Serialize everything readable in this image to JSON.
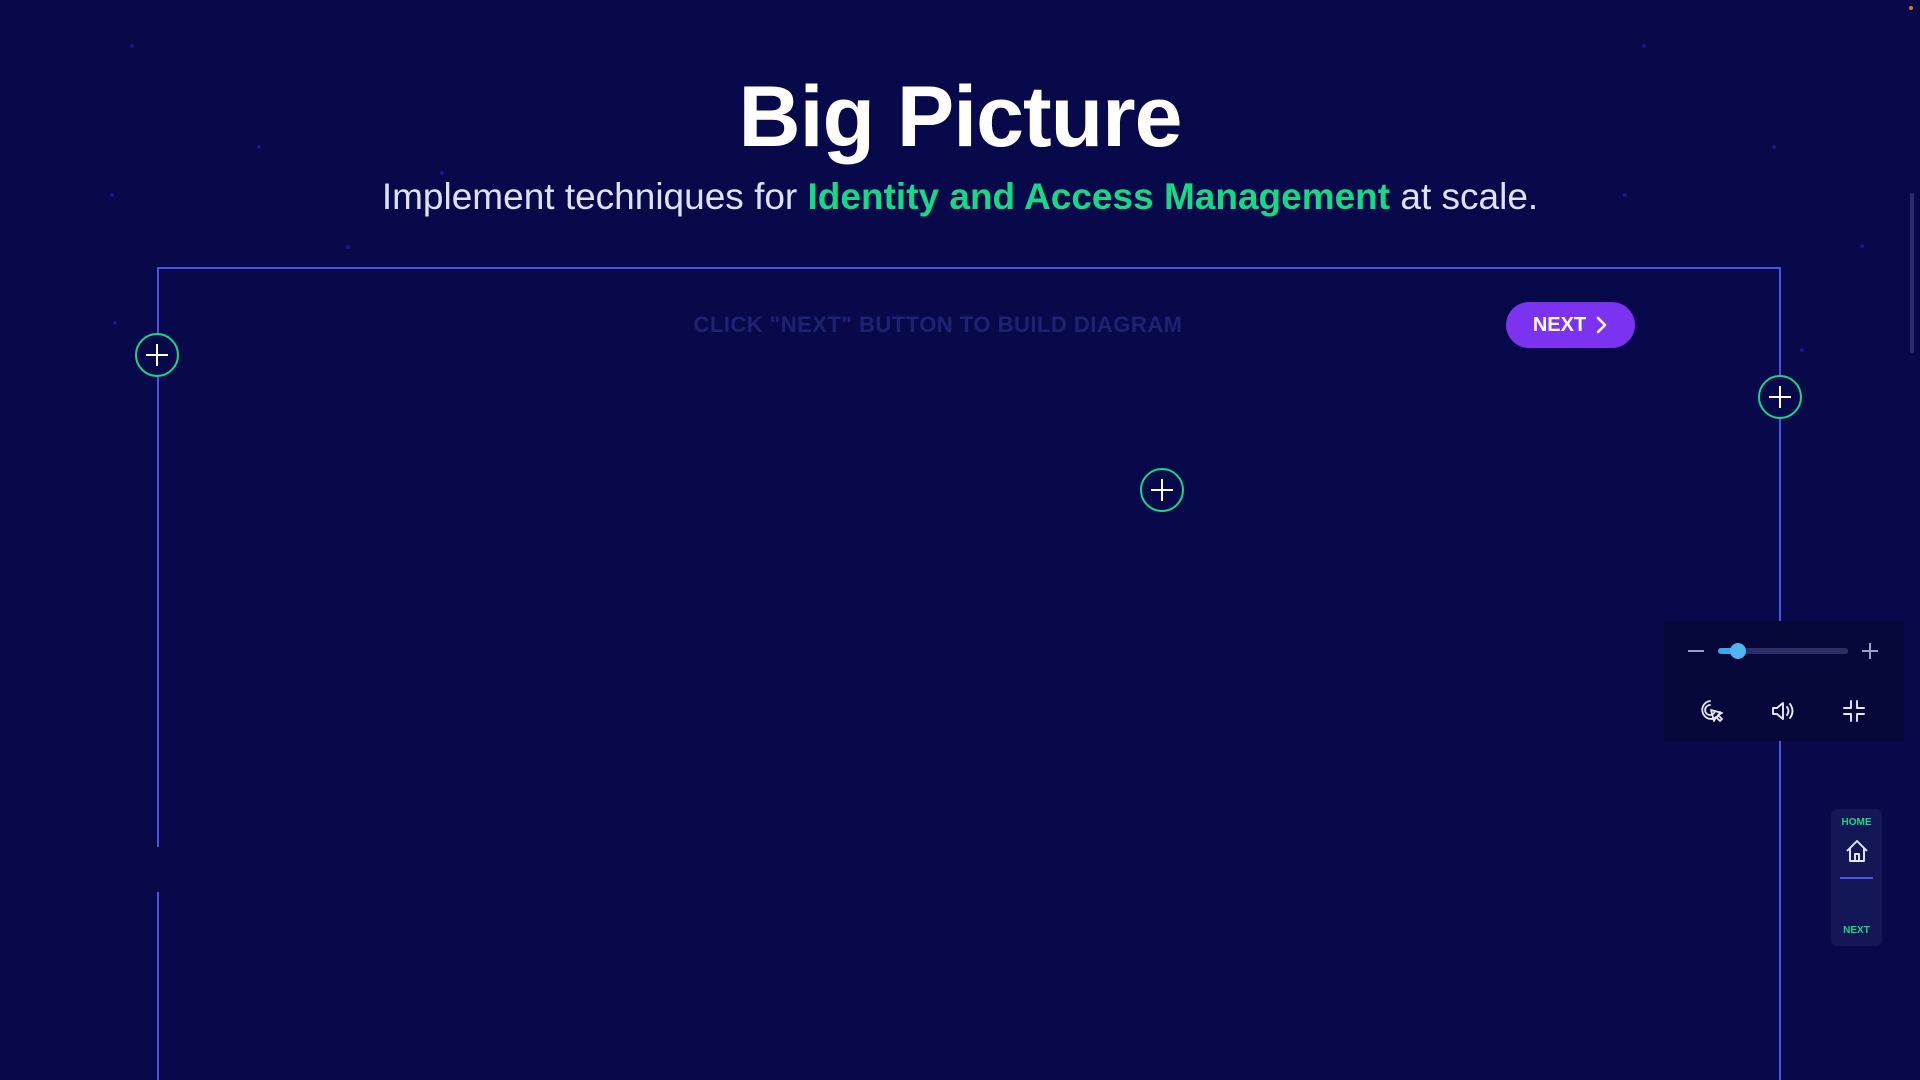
{
  "header": {
    "title": "Big Picture",
    "subtitle_prefix": "Implement techniques for ",
    "subtitle_highlight": "Identity and Access Management",
    "subtitle_suffix": " at scale."
  },
  "diagram": {
    "hint": "CLICK \"NEXT\" BUTTON TO BUILD DIAGRAM",
    "next_label": "NEXT",
    "expand_buttons": [
      "plus-icon",
      "plus-icon",
      "plus-icon"
    ]
  },
  "controls": {
    "zoom_level": 0.15,
    "icons": [
      "zoom-out-icon",
      "zoom-in-icon",
      "pointer-icon",
      "volume-icon",
      "exit-fullscreen-icon"
    ]
  },
  "nav": {
    "home_label": "HOME",
    "next_label": "NEXT",
    "home_icon": "home-icon"
  },
  "colors": {
    "background": "#08094a",
    "accent_green": "#17d884",
    "frame_blue": "#4b52e8",
    "next_purple": "#7b33f0",
    "slider_blue": "#3aa8e8"
  }
}
